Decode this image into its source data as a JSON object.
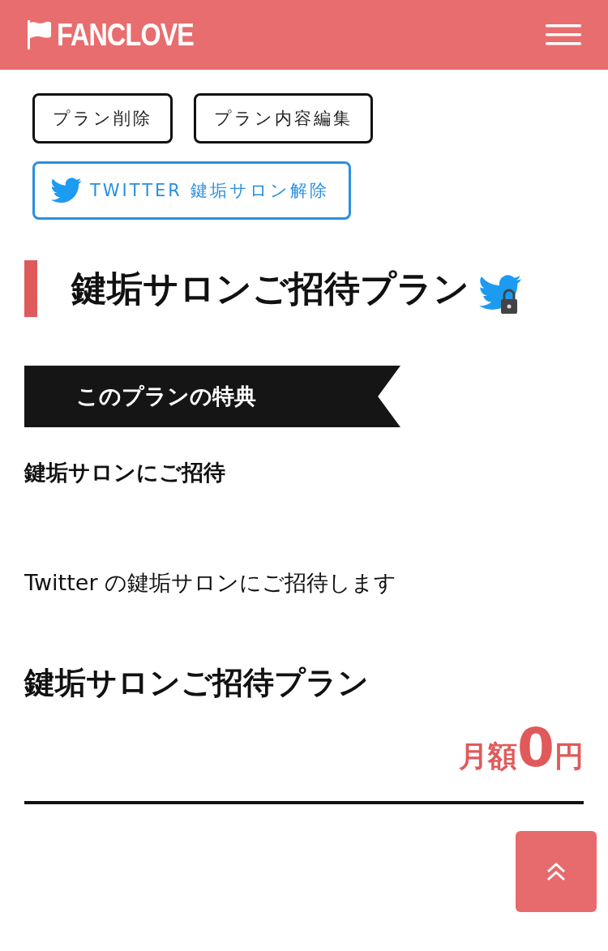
{
  "header": {
    "logo": "FANCLOVE"
  },
  "buttons": [
    {
      "label": "プラン削除",
      "kind": "plain"
    },
    {
      "label": "プラン内容編集",
      "kind": "plain"
    },
    {
      "label": "TWITTER 鍵垢サロン解除",
      "kind": "twitter"
    }
  ],
  "title": "鍵垢サロンご招待プラン",
  "benefit_ribbon": "このプランの特典",
  "benefit_heading": "鍵垢サロンにご招待",
  "description": "Twitter の鍵垢サロンにご招待します",
  "plan_name": "鍵垢サロンご招待プラン",
  "price": {
    "prefix": "月額",
    "amount": "0",
    "unit": "円"
  }
}
